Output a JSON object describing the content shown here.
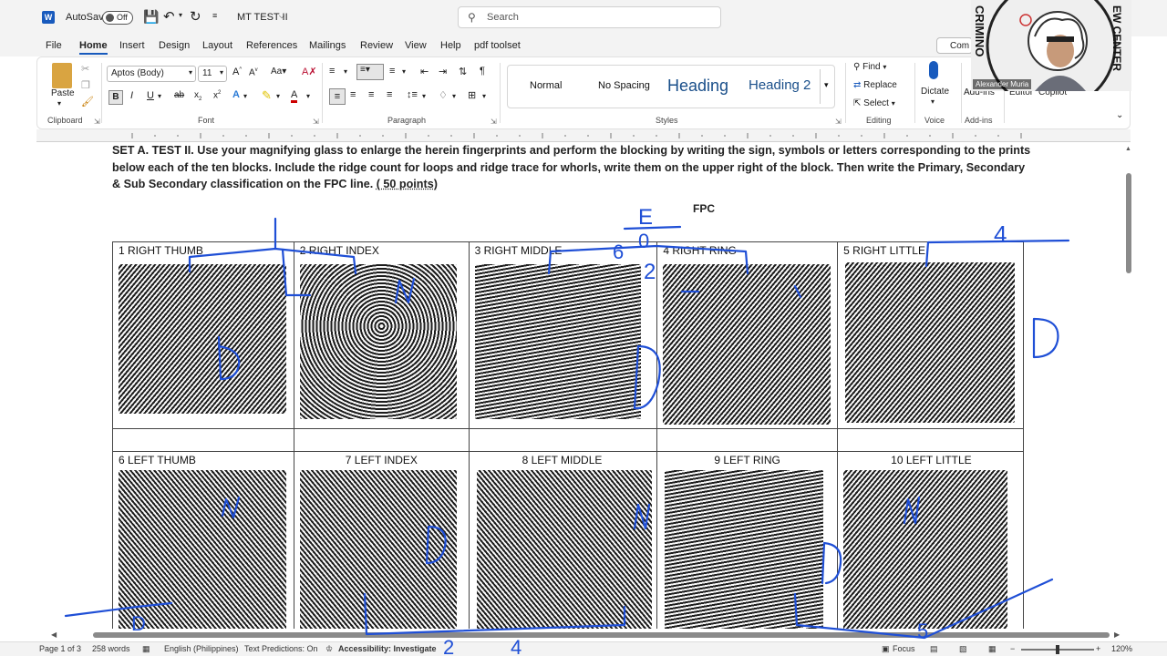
{
  "titlebar": {
    "app_logo": "W",
    "autosave_label": "AutoSave",
    "autosave_state": "Off",
    "doc_title": "MT TEST II",
    "search_placeholder": "Search"
  },
  "menu": [
    "File",
    "Home",
    "Insert",
    "Design",
    "Layout",
    "References",
    "Mailings",
    "Review",
    "View",
    "Help",
    "pdf toolset"
  ],
  "comment_button": "Com",
  "ribbon": {
    "clipboard": {
      "paste": "Paste",
      "group": "Clipboard"
    },
    "font": {
      "name": "Aptos (Body)",
      "size": "11",
      "group": "Font"
    },
    "paragraph": {
      "group": "Paragraph"
    },
    "styles": {
      "normal": "Normal",
      "nospacing": "No Spacing",
      "heading1": "Heading",
      "heading2": "Heading 2",
      "group": "Styles"
    },
    "editing": {
      "find": "Find",
      "replace": "Replace",
      "select": "Select",
      "group": "Editing"
    },
    "voice": {
      "dictate": "Dictate",
      "group": "Voice"
    },
    "addins": {
      "label": "Add-ins",
      "group": "Add-ins"
    },
    "editor": "Editor",
    "copilot": "Copilot"
  },
  "webcam": {
    "name": "Alexander Muria",
    "seal_top": "CRIMINO",
    "seal_right": "EW CENTER"
  },
  "document": {
    "instructions": "SET A.  TEST II. Use your magnifying glass to enlarge the herein fingerprints and perform the blocking by writing the sign, symbols or letters corresponding to the prints below each of the ten blocks. Include the ridge count for loops and ridge trace for whorls, write them on the upper right of the block. Then write the Primary, Secondary & Sub Secondary classification on the FPC line. ",
    "points": "( 50 points)",
    "fpc": "FPC",
    "right_hand": [
      "1 RIGHT THUMB",
      "2 RIGHT INDEX",
      "3 RIGHT MIDDLE",
      "4 RIGHT RING",
      "5 RIGHT LITTLE"
    ],
    "left_hand": [
      "6 LEFT THUMB",
      "7 LEFT INDEX",
      "8 LEFT MIDDLE",
      "9 LEFT RING",
      "10 LEFT LITTLE"
    ]
  },
  "status": {
    "page": "Page 1 of 3",
    "words": "258 words",
    "language": "English (Philippines)",
    "predictions": "Text Predictions: On",
    "accessibility": "Accessibility: Investigate",
    "focus": "Focus",
    "zoom": "120%"
  },
  "annotations": [
    "E",
    "6",
    "0",
    "2",
    "4",
    "D",
    "N",
    "N",
    "D",
    "D",
    "N",
    "D",
    "L",
    "5",
    "2",
    "4"
  ],
  "colors": {
    "ink": "#1f4fd6",
    "word_blue": "#185abd"
  }
}
